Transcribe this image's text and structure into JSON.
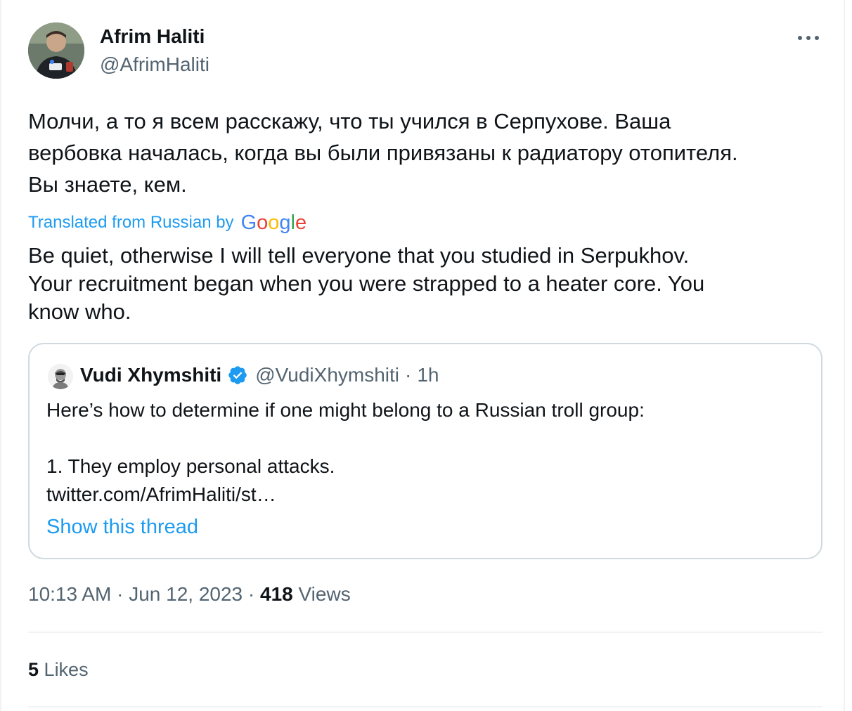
{
  "author": {
    "name": "Afrim Haliti",
    "handle": "@AfrimHaliti",
    "avatar_icon": "profile-photo"
  },
  "tweet": {
    "text_lines": [
      "Молчи, а то я всем расскажу, что ты учился в Серпухове. Ваша",
      "вербовка началась, когда вы были привязаны к радиатору отопителя.",
      "Вы знаете, кем."
    ],
    "translated_label": "Translated from Russian by",
    "translation_provider": {
      "letters": [
        "G",
        "o",
        "o",
        "g",
        "l",
        "e"
      ]
    },
    "translation_lines": [
      "Be quiet, otherwise I will tell everyone that you studied in Serpukhov.",
      "Your recruitment began when you were strapped to a heater core. You",
      "know who."
    ]
  },
  "quote": {
    "name": "Vudi Xhymshiti",
    "handle": "@VudiXhymshiti",
    "separator": "·",
    "time": "1h",
    "verified_icon": "verified-badge-icon",
    "body_lines": [
      "Here’s how to determine if one might belong to a Russian troll group:",
      "",
      "1. They employ personal attacks.",
      "twitter.com/AfrimHaliti/st…"
    ],
    "show_thread": "Show this thread"
  },
  "meta": {
    "time": "10:13 AM",
    "separator": "·",
    "date": "Jun 12, 2023",
    "views_count": "418",
    "views_label": "Views"
  },
  "likes": {
    "count": "5",
    "label": "Likes"
  },
  "colors": {
    "link": "#1d9bf0",
    "secondary": "#536471",
    "border": "#cfd9de",
    "divider": "#eff3f4",
    "verified": "#1d9bf0"
  }
}
